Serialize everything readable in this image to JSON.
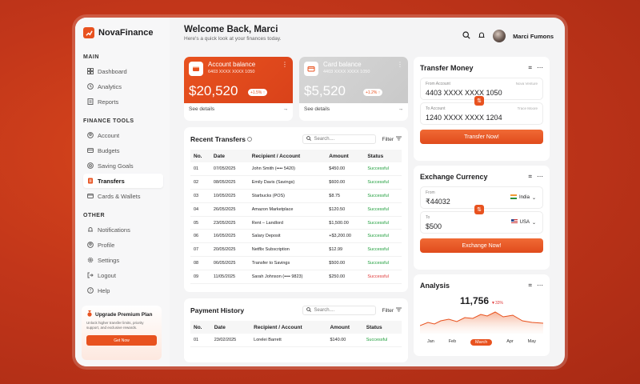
{
  "brand": {
    "name": "NovaFinance"
  },
  "sidebar": {
    "main_title": "MAIN",
    "main": [
      {
        "label": "Dashboard",
        "icon": "grid-icon"
      },
      {
        "label": "Analytics",
        "icon": "clock-icon"
      },
      {
        "label": "Reports",
        "icon": "report-icon"
      }
    ],
    "tools_title": "FINANCE TOOLS",
    "tools": [
      {
        "label": "Account",
        "icon": "account-icon"
      },
      {
        "label": "Budgets",
        "icon": "budget-icon"
      },
      {
        "label": "Saving Goals",
        "icon": "goal-icon"
      },
      {
        "label": "Transfers",
        "icon": "transfer-icon",
        "active": true
      },
      {
        "label": "Cards & Wallets",
        "icon": "card-icon"
      }
    ],
    "other_title": "OTHER",
    "other": [
      {
        "label": "Notifications",
        "icon": "bell-icon"
      },
      {
        "label": "Profile",
        "icon": "user-icon"
      },
      {
        "label": "Settings",
        "icon": "gear-icon"
      },
      {
        "label": "Logout",
        "icon": "logout-icon"
      },
      {
        "label": "Help",
        "icon": "help-icon"
      }
    ],
    "upgrade": {
      "title": "Upgrade Premium Plan",
      "text": "Unlock higher transfer limits, priority support, and exclusive rewards.",
      "button": "Get Now"
    }
  },
  "header": {
    "title": "Welcome Back, Marci",
    "subtitle": "Here's a quick look at your finances today.",
    "user": "Marci Fumons"
  },
  "account_card": {
    "label": "Account balance",
    "number": "6403 XXXX XXXX 1050",
    "amount": "$20,520",
    "badge": "+1.5% ↑",
    "details": "See details"
  },
  "card_balance": {
    "label": "Card balance",
    "number": "4403 XXXX XXXX 1050",
    "amount": "$5,520",
    "badge": "+1.2% ↑",
    "details": "See details"
  },
  "recent_transfers": {
    "title": "Recent Transfers",
    "search_placeholder": "Search....",
    "filter": "Filter",
    "headers": [
      "No.",
      "Date",
      "Recipient / Account",
      "Amount",
      "Status"
    ],
    "rows": [
      [
        "01",
        "07/05/2025",
        "John Smith (•••• 5420)",
        "$450.00",
        "Successful"
      ],
      [
        "02",
        "08/05/2025",
        "Emily Davis (Savings)",
        "$600.00",
        "Successful"
      ],
      [
        "03",
        "10/05/2025",
        "Starbucks (POS)",
        "$8.75",
        "Successful"
      ],
      [
        "04",
        "26/05/2025",
        "Amazon Marketplace",
        "$120.50",
        "Successful"
      ],
      [
        "05",
        "23/05/2025",
        "Rent – Landlord",
        "$1,500.00",
        "Successful"
      ],
      [
        "06",
        "16/05/2025",
        "Salary Deposit",
        "+$3,200.00",
        "Successful"
      ],
      [
        "07",
        "20/05/2025",
        "Netflix Subscription",
        "$12.99",
        "Successful"
      ],
      [
        "08",
        "06/05/2025",
        "Transfer to Savings",
        "$500.00",
        "Successful"
      ],
      [
        "09",
        "11/05/2025",
        "Sarah Johnson (•••• 9823)",
        "$250.00",
        "Successful"
      ]
    ]
  },
  "payment_history": {
    "title": "Payment History",
    "search_placeholder": "Search....",
    "filter": "Filter",
    "headers": [
      "No.",
      "Date",
      "Recipient / Account",
      "Amount",
      "Status"
    ],
    "rows": [
      [
        "01",
        "23/02/2025",
        "Lorelei Barrett",
        "$140.00",
        "Successful"
      ]
    ]
  },
  "transfer_money": {
    "title": "Transfer Money",
    "from_label": "From Account",
    "from_hint": "Nova Venture",
    "from_value": "4403 XXXX XXXX 1050",
    "to_label": "To Account",
    "to_hint": "Trace Moore",
    "to_value": "1240 XXXX XXXX 1204",
    "button": "Transfer Now!"
  },
  "exchange": {
    "title": "Exchange Currency",
    "from_label": "From",
    "from_value": "₹44032",
    "from_currency": "India",
    "to_label": "To",
    "to_value": "$500",
    "to_currency": "USA",
    "button": "Exchange Now!"
  },
  "analysis": {
    "title": "Analysis",
    "value": "11,756",
    "delta": "▼33%",
    "months": [
      "Jan",
      "Feb",
      "March",
      "Apr",
      "May"
    ],
    "active_month": "March"
  },
  "colors": {
    "accent": "#e8521f",
    "success": "#1e9e3b",
    "danger": "#e03a3a"
  }
}
